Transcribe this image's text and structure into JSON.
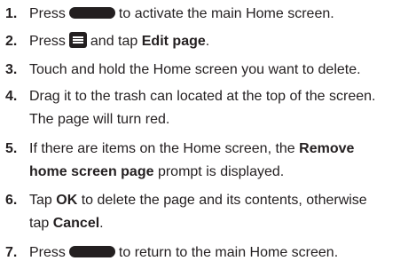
{
  "steps": [
    {
      "number": "1.",
      "part1": "Press",
      "part2": "to activate the main Home screen."
    },
    {
      "number": "2.",
      "part1": "Press",
      "part2": "and tap",
      "bold": "Edit page",
      "end": "."
    },
    {
      "number": "3.",
      "text": "Touch and hold the Home screen you want to delete."
    },
    {
      "number": "4.",
      "line1": "Drag it to the trash can located at the top of the screen.",
      "line2": "The page will turn red."
    },
    {
      "number": "5.",
      "line1_part1": "If there are items on the Home screen, the",
      "line1_bold": "Remove",
      "line2_bold": "home screen page",
      "line2_part2": "prompt is displayed."
    },
    {
      "number": "6.",
      "line1_part1": "Tap",
      "line1_bold": "OK",
      "line1_part2": "to delete the page and its contents, otherwise",
      "line2_part1": "tap",
      "line2_bold": "Cancel",
      "line2_end": "."
    },
    {
      "number": "7.",
      "part1": "Press",
      "part2": "to return to the main Home screen."
    }
  ],
  "icons": {
    "home_key": "home-key-icon",
    "menu_key": "menu-key-icon"
  }
}
